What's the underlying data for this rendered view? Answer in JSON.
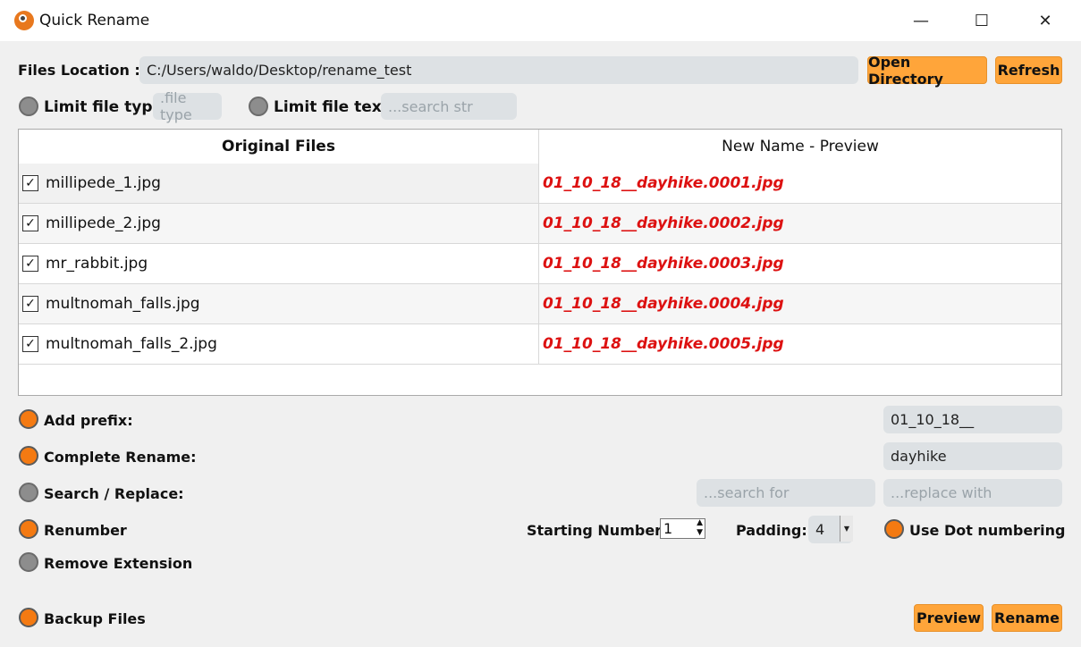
{
  "window": {
    "title": "Quick Rename",
    "controls": {
      "minimize": "—",
      "maximize": "☐",
      "close": "✕"
    }
  },
  "location": {
    "label": "Files Location :",
    "path": "C:/Users/waldo/Desktop/rename_test",
    "open_button": "Open Directory",
    "refresh_button": "Refresh"
  },
  "filters": {
    "type_label": "Limit file type",
    "type_placeholder": ".file type",
    "type_enabled": false,
    "text_label": "Limit file text",
    "text_placeholder": "...search str",
    "text_enabled": false
  },
  "table": {
    "col_original": "Original Files",
    "col_new": "New Name - Preview",
    "rows": [
      {
        "checked": true,
        "original": "millipede_1.jpg",
        "new": "01_10_18__dayhike.0001.jpg"
      },
      {
        "checked": true,
        "original": "millipede_2.jpg",
        "new": "01_10_18__dayhike.0002.jpg"
      },
      {
        "checked": true,
        "original": "mr_rabbit.jpg",
        "new": "01_10_18__dayhike.0003.jpg"
      },
      {
        "checked": true,
        "original": "multnomah_falls.jpg",
        "new": "01_10_18__dayhike.0004.jpg"
      },
      {
        "checked": true,
        "original": "multnomah_falls_2.jpg",
        "new": "01_10_18__dayhike.0005.jpg"
      }
    ]
  },
  "options": {
    "prefix": {
      "label": "Add prefix:",
      "enabled": true,
      "value": "01_10_18__"
    },
    "complete_rename": {
      "label": "Complete Rename:",
      "enabled": true,
      "value": "dayhike"
    },
    "search_replace": {
      "label": "Search / Replace:",
      "enabled": false,
      "search_placeholder": "...search for",
      "replace_placeholder": "...replace with"
    },
    "renumber": {
      "label": "Renumber",
      "enabled": true,
      "start_label": "Starting Number:",
      "start_value": "1",
      "padding_label": "Padding:",
      "padding_value": "4",
      "dot_label": "Use Dot numbering",
      "dot_enabled": true
    },
    "remove_extension": {
      "label": "Remove Extension",
      "enabled": false
    },
    "backup": {
      "label": "Backup Files",
      "enabled": true
    }
  },
  "actions": {
    "preview": "Preview",
    "rename": "Rename"
  },
  "colors": {
    "accent": "#ffa53a",
    "radio_on": "#f47a12",
    "radio_off": "#8d8d8d",
    "preview_text": "#dd1111"
  },
  "icons": {
    "check": "✓",
    "spin_up": "▲",
    "spin_down": "▼",
    "dropdown": "▼"
  }
}
